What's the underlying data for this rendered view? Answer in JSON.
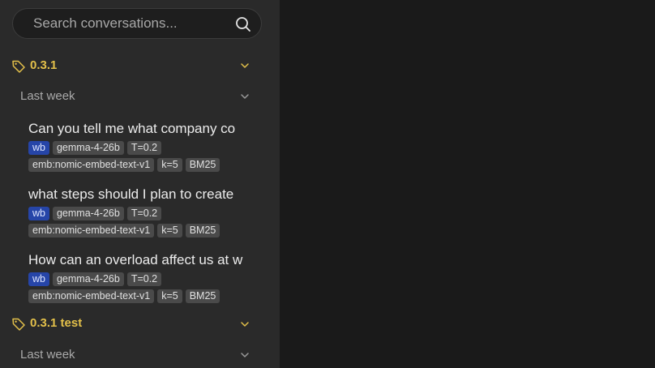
{
  "search": {
    "placeholder": "Search conversations..."
  },
  "colors": {
    "accent_yellow": "#e3c04a",
    "wb_badge": "#2645a8",
    "badge_bg": "#4a4a4a",
    "sidebar_bg": "#2a2a2a",
    "main_bg": "#1a1a1a"
  },
  "groups": [
    {
      "label": "0.3.1",
      "icon": "tag-icon",
      "sections": [
        {
          "label": "Last week",
          "conversations": [
            {
              "title": "Can you tell me what company co",
              "badges_row1": [
                "wb",
                "gemma-4-26b",
                "T=0.2"
              ],
              "badges_row2": [
                "emb:nomic-embed-text-v1",
                "k=5",
                "BM25"
              ]
            },
            {
              "title": "what steps should I plan to create",
              "badges_row1": [
                "wb",
                "gemma-4-26b",
                "T=0.2"
              ],
              "badges_row2": [
                "emb:nomic-embed-text-v1",
                "k=5",
                "BM25"
              ]
            },
            {
              "title": "How can an overload affect us at w",
              "badges_row1": [
                "wb",
                "gemma-4-26b",
                "T=0.2"
              ],
              "badges_row2": [
                "emb:nomic-embed-text-v1",
                "k=5",
                "BM25"
              ]
            }
          ]
        }
      ]
    },
    {
      "label": "0.3.1 test",
      "icon": "tag-icon",
      "sections": [
        {
          "label": "Last week",
          "conversations": []
        }
      ]
    }
  ]
}
